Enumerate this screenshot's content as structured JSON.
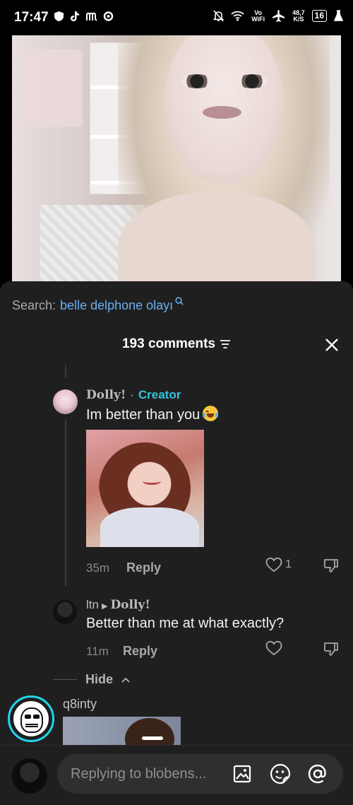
{
  "status_bar": {
    "time": "17:47",
    "network_speed_top": "48,7",
    "network_speed_unit": "K/S",
    "vowifi_top": "Vo",
    "vowifi_bottom": "WiFi",
    "battery": "16",
    "icons": [
      "shield-icon",
      "tiktok-icon",
      "m-icon",
      "sync-icon",
      "mute-icon",
      "wifi-icon",
      "airplane-icon",
      "battery-icon",
      "flask-icon"
    ]
  },
  "search": {
    "label": "Search:",
    "query": "belle delphone olayı"
  },
  "header": {
    "comments_count": "193 comments"
  },
  "comments": [
    {
      "author": "Dolly!",
      "separator": "·",
      "badge": "Creator",
      "text": "Im better than you",
      "emoji": "face-with-tears-of-joy",
      "time": "35m",
      "reply_label": "Reply",
      "likes": "1"
    },
    {
      "author": "ltn",
      "reply_to": "Dolly!",
      "text": "Better than me at what exactly?",
      "time": "11m",
      "reply_label": "Reply"
    }
  ],
  "hide_label": "Hide",
  "next_comment": {
    "author": "q8inty"
  },
  "reply_bar": {
    "placeholder": "Replying to blobens..."
  },
  "colors": {
    "accent_link": "#6ab0f3",
    "creator_badge": "#36c6de",
    "sheet_bg": "#1f1f1f",
    "story_ring": "#20d5ec"
  }
}
